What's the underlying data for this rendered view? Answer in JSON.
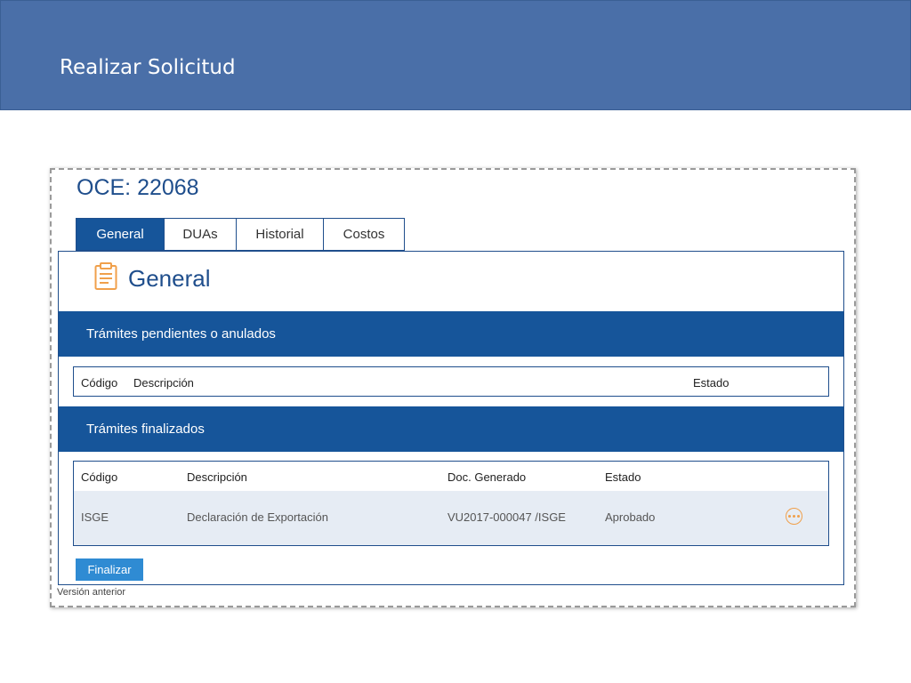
{
  "slide": {
    "title": "Realizar Solicitud"
  },
  "page": {
    "oce_title": "OCE: 22068",
    "tabs": [
      {
        "label": "General",
        "active": true
      },
      {
        "label": "DUAs",
        "active": false
      },
      {
        "label": "Historial",
        "active": false
      },
      {
        "label": "Costos",
        "active": false
      }
    ],
    "section": {
      "icon": "clipboard-icon",
      "title": "General"
    },
    "pending": {
      "title": "Trámites pendientes o anulados",
      "columns": [
        "Código",
        "Descripción",
        "Estado"
      ]
    },
    "finished": {
      "title": "Trámites finalizados",
      "columns": [
        "Código",
        "Descripción",
        "Doc. Generado",
        "Estado"
      ],
      "rows": [
        {
          "codigo": "ISGE",
          "descripcion": "Declaración de Exportación",
          "doc": "VU2017-000047 /ISGE",
          "estado": "Aprobado",
          "action_icon": "more-options-icon"
        }
      ]
    },
    "finalizar_label": "Finalizar",
    "version_link": "Versión anterior"
  },
  "colors": {
    "banner": "#4a6fa8",
    "primary": "#16559a",
    "title_blue": "#1f4e8c",
    "button": "#2f8bd3",
    "icon_orange": "#f0a04b",
    "row_bg": "#e6ecf4"
  }
}
